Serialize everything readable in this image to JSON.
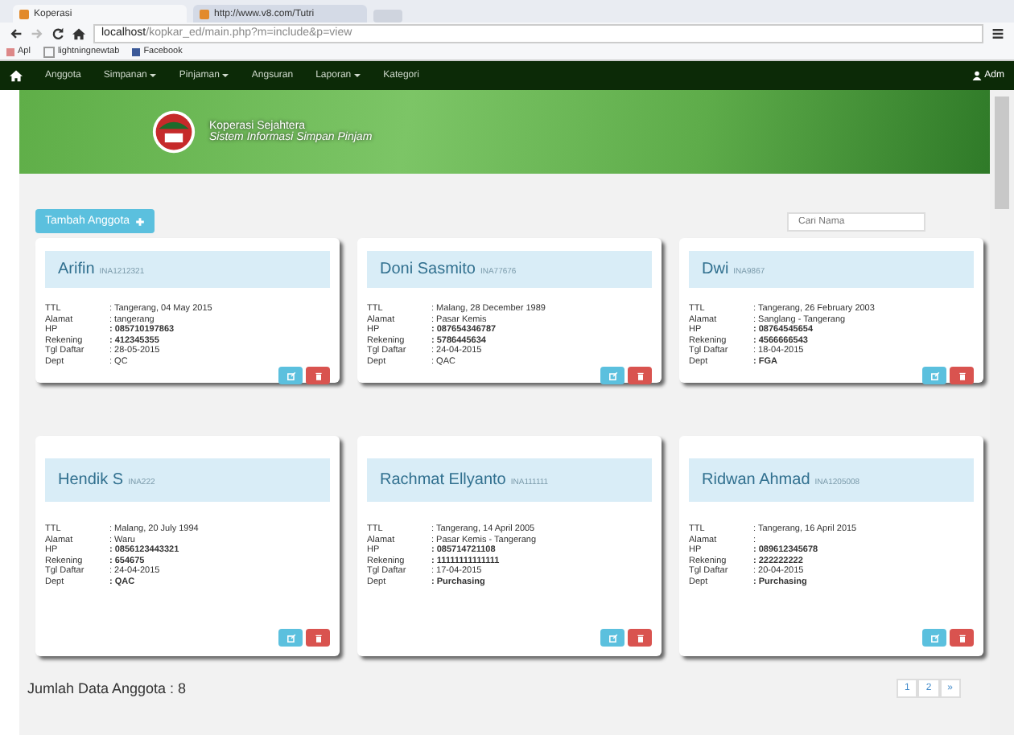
{
  "browser": {
    "tabs": [
      {
        "title": "Koperasi",
        "selected": true
      },
      {
        "title": "http://www.v8.com/Tutri",
        "selected": false
      }
    ],
    "url_host": "localhost",
    "url_path": "/kopkar_ed/main.php?m=include&p=view",
    "bookmarks": [
      "Apl",
      "lightningnewtab",
      "Facebook"
    ]
  },
  "nav": {
    "items": [
      {
        "label": "Anggota",
        "dropdown": false
      },
      {
        "label": "Simpanan",
        "dropdown": true
      },
      {
        "label": "Pinjaman",
        "dropdown": true
      },
      {
        "label": "Angsuran",
        "dropdown": false
      },
      {
        "label": "Laporan",
        "dropdown": true
      },
      {
        "label": "Kategori",
        "dropdown": false
      }
    ],
    "user": "Adm"
  },
  "banner": {
    "title": "Koperasi Sejahtera",
    "subtitle": "Sistem Informasi Simpan Pinjam"
  },
  "add_button": "Tambah Anggota",
  "search": {
    "placeholder": "Cari Nama"
  },
  "members": [
    {
      "name": "Arifin",
      "id": "INA1212321",
      "fields": [
        {
          "label": "TTL",
          "value": ": Tangerang, 04 May 2015",
          "bold": false
        },
        {
          "label": "Alamat",
          "value": ": tangerang",
          "bold": false
        },
        {
          "label": "HP",
          "value": ": 085710197863",
          "bold": true
        },
        {
          "label": "Rekening",
          "value": ": 412345355",
          "bold": true
        },
        {
          "label": "Tgl Daftar",
          "value": ": 28-05-2015",
          "bold": false
        },
        {
          "label": "Dept",
          "value": ": QC",
          "bold": false
        }
      ]
    },
    {
      "name": "Doni Sasmito",
      "id": "INA77676",
      "fields": [
        {
          "label": "TTL",
          "value": ": Malang, 28 December 1989",
          "bold": false
        },
        {
          "label": "Alamat",
          "value": ": Pasar Kemis",
          "bold": false
        },
        {
          "label": "HP",
          "value": ": 087654346787",
          "bold": true
        },
        {
          "label": "Rekening",
          "value": ": 5786445634",
          "bold": true
        },
        {
          "label": "Tgl Daftar",
          "value": ": 24-04-2015",
          "bold": false
        },
        {
          "label": "Dept",
          "value": ": QAC",
          "bold": false
        }
      ]
    },
    {
      "name": "Dwi",
      "id": "INA9867",
      "fields": [
        {
          "label": "TTL",
          "value": ": Tangerang, 26 February 2003",
          "bold": false
        },
        {
          "label": "Alamat",
          "value": ": Sanglang - Tangerang",
          "bold": false
        },
        {
          "label": "HP",
          "value": ": 08764545654",
          "bold": true
        },
        {
          "label": "Rekening",
          "value": ": 4566666543",
          "bold": true
        },
        {
          "label": "Tgl Daftar",
          "value": ": 18-04-2015",
          "bold": false
        },
        {
          "label": "Dept",
          "value": ": FGA",
          "bold": true
        }
      ]
    },
    {
      "name": "Hendik S",
      "id": "INA222",
      "fields": [
        {
          "label": "TTL",
          "value": ": Malang, 20 July 1994",
          "bold": false
        },
        {
          "label": "Alamat",
          "value": ": Waru",
          "bold": false
        },
        {
          "label": "HP",
          "value": ": 0856123443321",
          "bold": true
        },
        {
          "label": "Rekening",
          "value": ": 654675",
          "bold": true
        },
        {
          "label": "Tgl Daftar",
          "value": ": 24-04-2015",
          "bold": false
        },
        {
          "label": "Dept",
          "value": ": QAC",
          "bold": true
        }
      ]
    },
    {
      "name": "Rachmat Ellyanto",
      "id": "INA111111",
      "fields": [
        {
          "label": "TTL",
          "value": ": Tangerang, 14 April 2005",
          "bold": false
        },
        {
          "label": "Alamat",
          "value": ": Pasar Kemis - Tangerang",
          "bold": false
        },
        {
          "label": "HP",
          "value": ": 085714721108",
          "bold": true
        },
        {
          "label": "Rekening",
          "value": ": 11111111111111",
          "bold": true
        },
        {
          "label": "Tgl Daftar",
          "value": ": 17-04-2015",
          "bold": false
        },
        {
          "label": "Dept",
          "value": ": Purchasing",
          "bold": true
        }
      ]
    },
    {
      "name": "Ridwan Ahmad",
      "id": "INA1205008",
      "fields": [
        {
          "label": "TTL",
          "value": ": Tangerang, 16 April 2015",
          "bold": false
        },
        {
          "label": "Alamat",
          "value": ":",
          "bold": false
        },
        {
          "label": "HP",
          "value": ": 089612345678",
          "bold": true
        },
        {
          "label": "Rekening",
          "value": ": 222222222",
          "bold": true
        },
        {
          "label": "Tgl Daftar",
          "value": ": 20-04-2015",
          "bold": false
        },
        {
          "label": "Dept",
          "value": ": Purchasing",
          "bold": true
        }
      ]
    }
  ],
  "footer": {
    "total": "Jumlah Data Anggota : 8",
    "pages": [
      "1",
      "2",
      "»"
    ]
  }
}
